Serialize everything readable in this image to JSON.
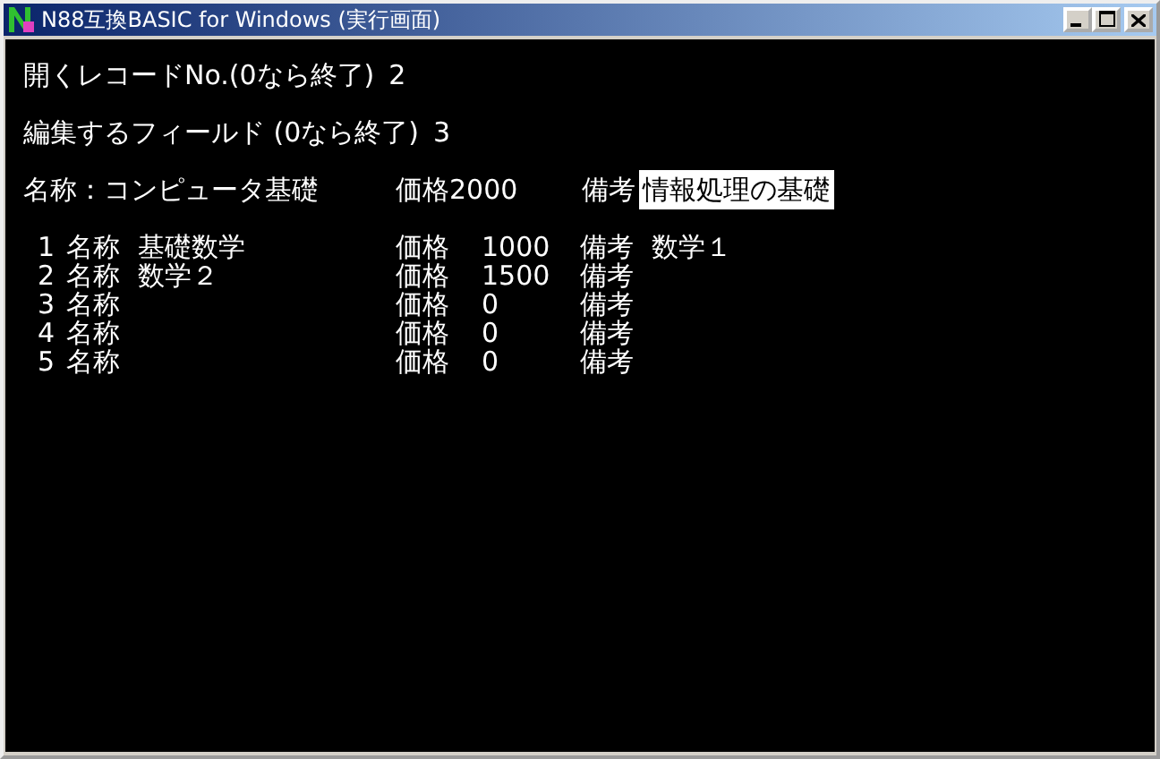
{
  "window": {
    "title": "N88互換BASIC for Windows (実行画面)"
  },
  "prompts": [
    {
      "label": "開くレコードNo.(0なら終了)",
      "value": "2"
    },
    {
      "label": "編集するフィールド (0なら終了)",
      "value": "3"
    }
  ],
  "edit_line": {
    "name": "名称：コンピュータ基礎",
    "price": "価格2000",
    "note_label": "備考",
    "note_input": "情報処理の基礎"
  },
  "records": [
    {
      "no": "1",
      "name_label": "名称",
      "name": "基礎数学",
      "price_label": "価格",
      "price": "1000",
      "note_label": "備考",
      "note": "数学１"
    },
    {
      "no": "2",
      "name_label": "名称",
      "name": "数学２",
      "price_label": "価格",
      "price": "1500",
      "note_label": "備考"
    },
    {
      "no": "3",
      "name_label": "名称",
      "price_label": "価格",
      "price": "0",
      "note_label": "備考"
    },
    {
      "no": "4",
      "name_label": "名称",
      "price_label": "価格",
      "price": "0",
      "note_label": "備考"
    },
    {
      "no": "5",
      "name_label": "名称",
      "price_label": "価格",
      "price": "0",
      "note_label": "備考"
    }
  ]
}
